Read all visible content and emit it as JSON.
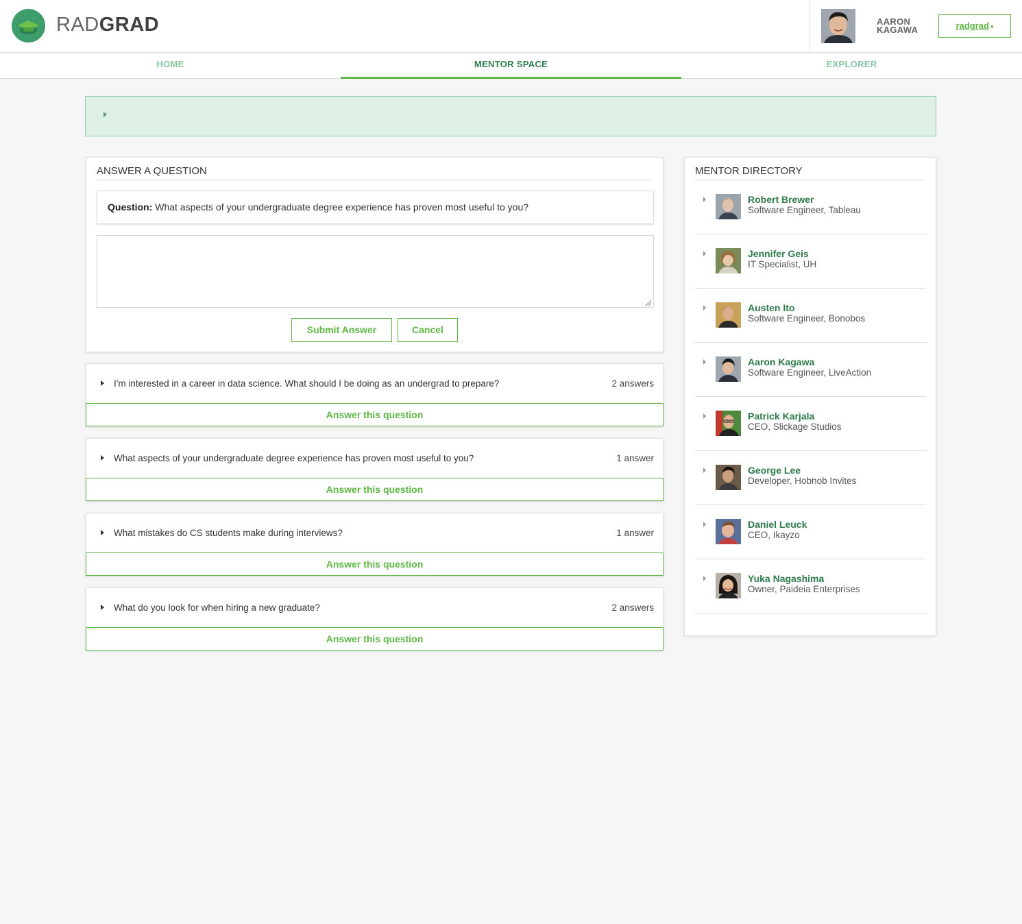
{
  "app": {
    "brand_light": "RAD",
    "brand_bold": "GRAD",
    "logo_icon": "graduation-cap-icon",
    "accent_color": "#5fb645",
    "brand_color": "#3e9e6b"
  },
  "user": {
    "first_name": "AARON",
    "last_name": "KAGAWA",
    "menu_label": "radgrad"
  },
  "nav": {
    "items": [
      {
        "label": "HOME",
        "active": false
      },
      {
        "label": "MENTOR SPACE",
        "active": true
      },
      {
        "label": "EXPLORER",
        "active": false
      }
    ]
  },
  "answer_panel": {
    "title": "ANSWER A QUESTION",
    "question_prefix": "Question:",
    "question_text": "What aspects of your undergraduate degree experience has proven most useful to you?",
    "answer_value": "",
    "submit_label": "Submit Answer",
    "cancel_label": "Cancel"
  },
  "questions": [
    {
      "text": "I'm interested in a career in data science. What should I be doing as an undergrad to prepare?",
      "count": "2 answers",
      "action": "Answer this question"
    },
    {
      "text": "What aspects of your undergraduate degree experience has proven most useful to you?",
      "count": "1 answer",
      "action": "Answer this question"
    },
    {
      "text": "What mistakes do CS students make during interviews?",
      "count": "1 answer",
      "action": "Answer this question"
    },
    {
      "text": "What do you look for when hiring a new graduate?",
      "count": "2 answers",
      "action": "Answer this question"
    }
  ],
  "directory": {
    "title": "MENTOR DIRECTORY",
    "mentors": [
      {
        "name": "Robert Brewer",
        "role": "Software Engineer, Tableau"
      },
      {
        "name": "Jennifer Geis",
        "role": "IT Specialist, UH"
      },
      {
        "name": "Austen Ito",
        "role": "Software Engineer, Bonobos"
      },
      {
        "name": "Aaron Kagawa",
        "role": "Software Engineer, LiveAction"
      },
      {
        "name": "Patrick Karjala",
        "role": "CEO, Slickage Studios"
      },
      {
        "name": "George Lee",
        "role": "Developer, Hobnob Invites"
      },
      {
        "name": "Daniel Leuck",
        "role": "CEO, Ikayzo"
      },
      {
        "name": "Yuka Nagashima",
        "role": "Owner, Paideia Enterprises"
      }
    ]
  }
}
